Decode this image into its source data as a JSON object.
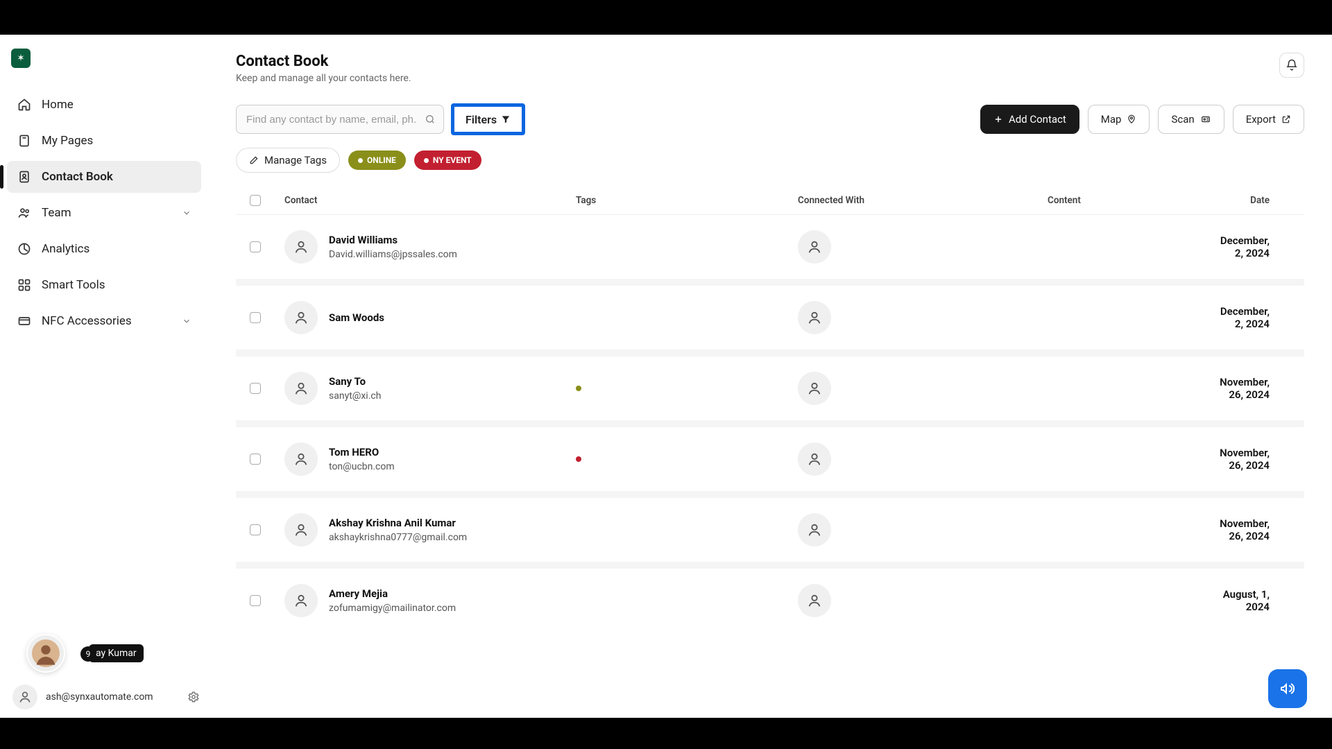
{
  "brand": {
    "logo_letter": "✶"
  },
  "sidebar": {
    "items": [
      {
        "label": "Home"
      },
      {
        "label": "My Pages"
      },
      {
        "label": "Contact Book"
      },
      {
        "label": "Team"
      },
      {
        "label": "Analytics"
      },
      {
        "label": "Smart Tools"
      },
      {
        "label": "NFC Accessories"
      }
    ]
  },
  "header": {
    "title": "Contact Book",
    "subtitle": "Keep and manage all your contacts here."
  },
  "toolbar": {
    "search_placeholder": "Find any contact by name, email, ph...",
    "filters": "Filters",
    "add_contact": "Add Contact",
    "map": "Map",
    "scan": "Scan",
    "export": "Export"
  },
  "tags": {
    "manage": "Manage Tags",
    "online": "ONLINE",
    "ny": "NY EVENT"
  },
  "columns": {
    "contact": "Contact",
    "tags": "Tags",
    "connected": "Connected With",
    "content": "Content",
    "date": "Date"
  },
  "rows": [
    {
      "name": "David Williams",
      "email": "David.williams@jpssales.com",
      "tag": "",
      "date": "December, 2, 2024"
    },
    {
      "name": "Sam Woods",
      "email": "",
      "tag": "",
      "date": "December, 2, 2024"
    },
    {
      "name": "Sany To",
      "email": "sanyt@xi.ch",
      "tag": "olive",
      "date": "November, 26, 2024"
    },
    {
      "name": "Tom HERO",
      "email": "ton@ucbn.com",
      "tag": "red",
      "date": "November, 26, 2024"
    },
    {
      "name": "Akshay Krishna Anil Kumar",
      "email": "akshaykrishna0777@gmail.com",
      "tag": "",
      "date": "November, 26, 2024"
    },
    {
      "name": "Amery Mejia",
      "email": "zofumamigy@mailinator.com",
      "tag": "",
      "date": "August, 1, 2024"
    }
  ],
  "user": {
    "badge": "9",
    "name_fragment": "ay Kumar",
    "email": "ash@synxautomate.com"
  }
}
